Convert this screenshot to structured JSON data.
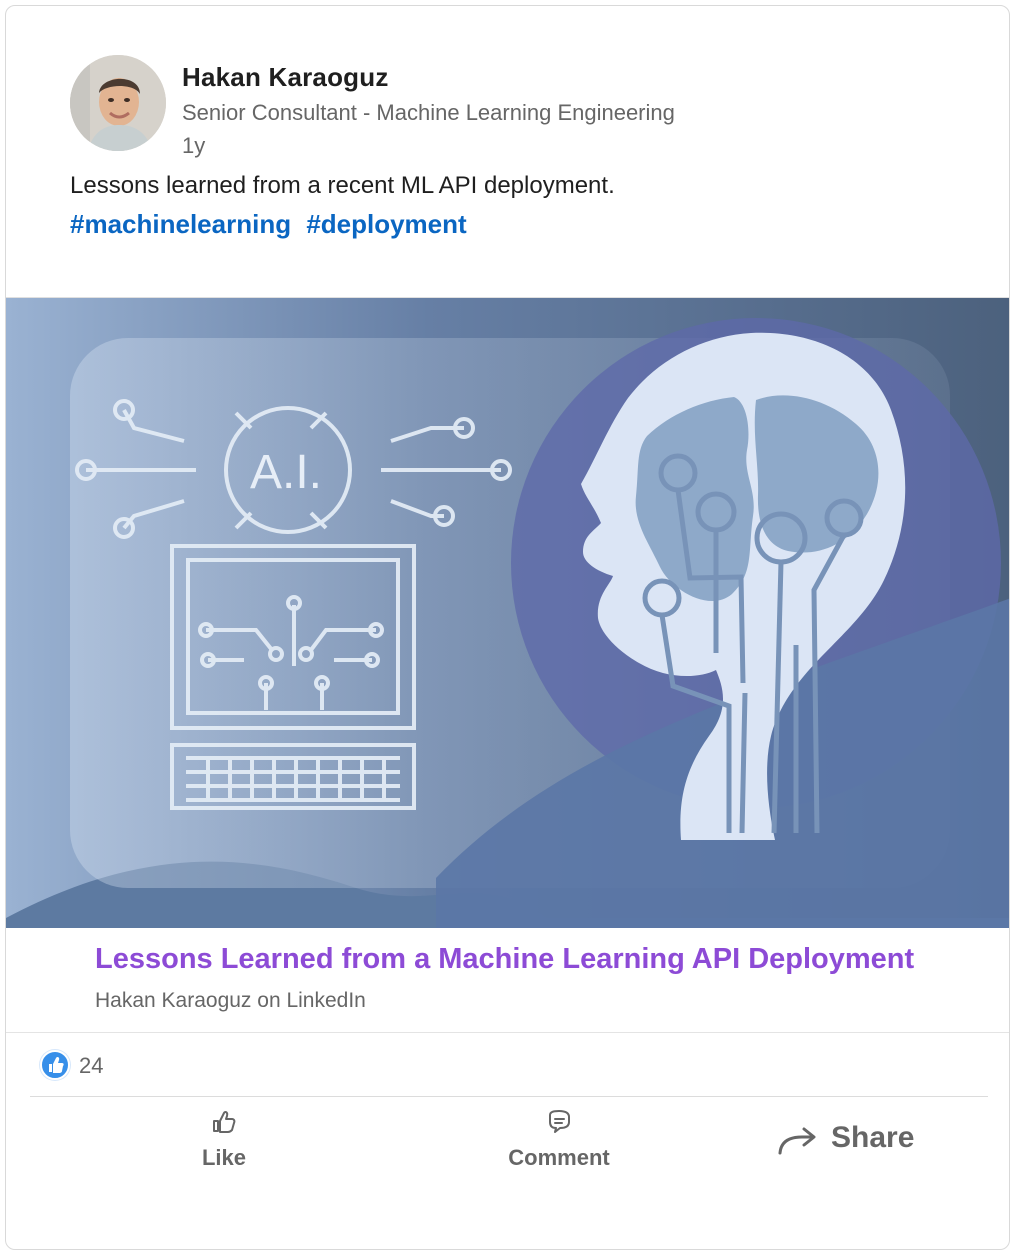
{
  "post": {
    "author": "Hakan Karaoguz",
    "headline": "Senior Consultant - Machine Learning Engineering",
    "time": "1y",
    "text": "Lessons learned from a recent ML API deployment.",
    "hashtags": [
      "#machinelearning",
      "#deployment"
    ]
  },
  "article": {
    "image_text": "A.I.",
    "title": "Lessons Learned from a Machine Learning API Deployment",
    "source": "Hakan Karaoguz on LinkedIn"
  },
  "social": {
    "reaction_icon": "thumbs-up-icon",
    "reactions": "24"
  },
  "actions": {
    "like": "Like",
    "comment": "Comment",
    "share": "Share"
  },
  "colors": {
    "accent": "#0a66c2",
    "article_title": "#8d4bd6"
  }
}
